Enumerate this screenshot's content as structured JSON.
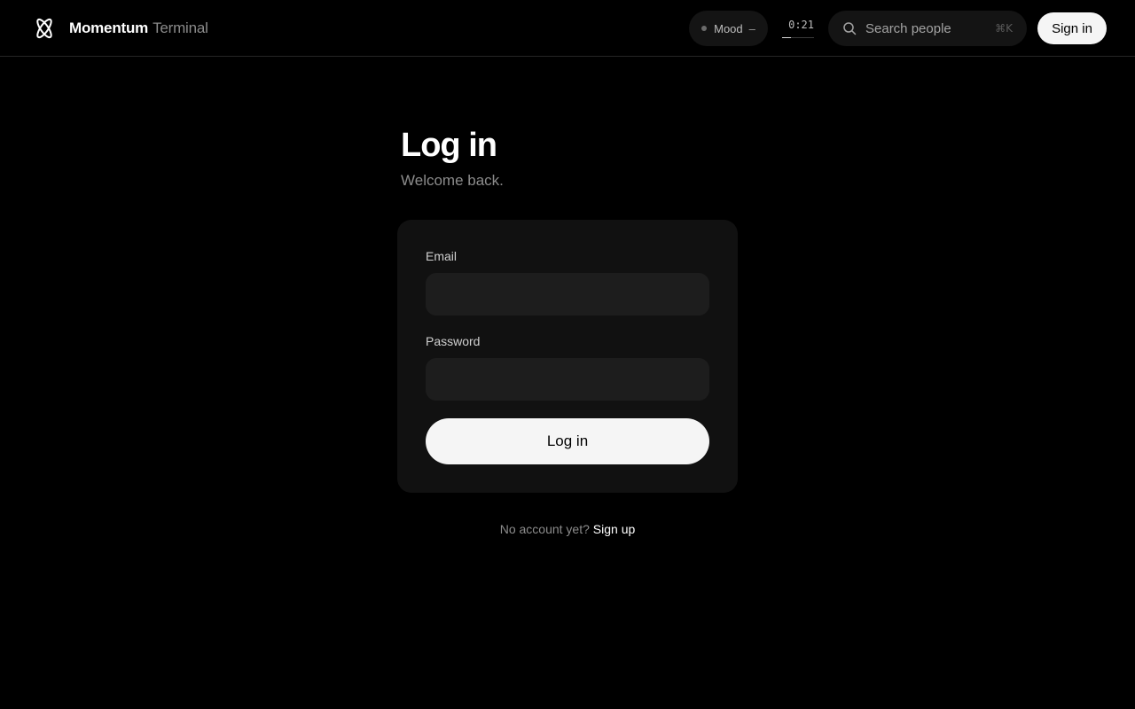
{
  "header": {
    "brand_name": "Momentum",
    "brand_sub": "Terminal",
    "logo_icon": "atom-icon",
    "mood": {
      "label": "Mood",
      "value": "–",
      "dot_color": "#6b6b6b"
    },
    "timer": {
      "text": "0:21",
      "progress_fraction": 0.28
    },
    "search": {
      "placeholder": "Search people",
      "shortcut": "⌘K",
      "icon": "search-icon"
    },
    "sign_in_label": "Sign in"
  },
  "main": {
    "title": "Log in",
    "subtitle": "Welcome back.",
    "form": {
      "email_label": "Email",
      "email_value": "",
      "password_label": "Password",
      "password_value": "",
      "submit_label": "Log in"
    },
    "footer": {
      "prompt": "No account yet?",
      "link_label": "Sign up"
    }
  },
  "colors": {
    "background": "#000000",
    "card": "#111111",
    "input": "#1d1d1d",
    "button": "#f5f5f5",
    "muted_text": "#8c8c8c"
  }
}
